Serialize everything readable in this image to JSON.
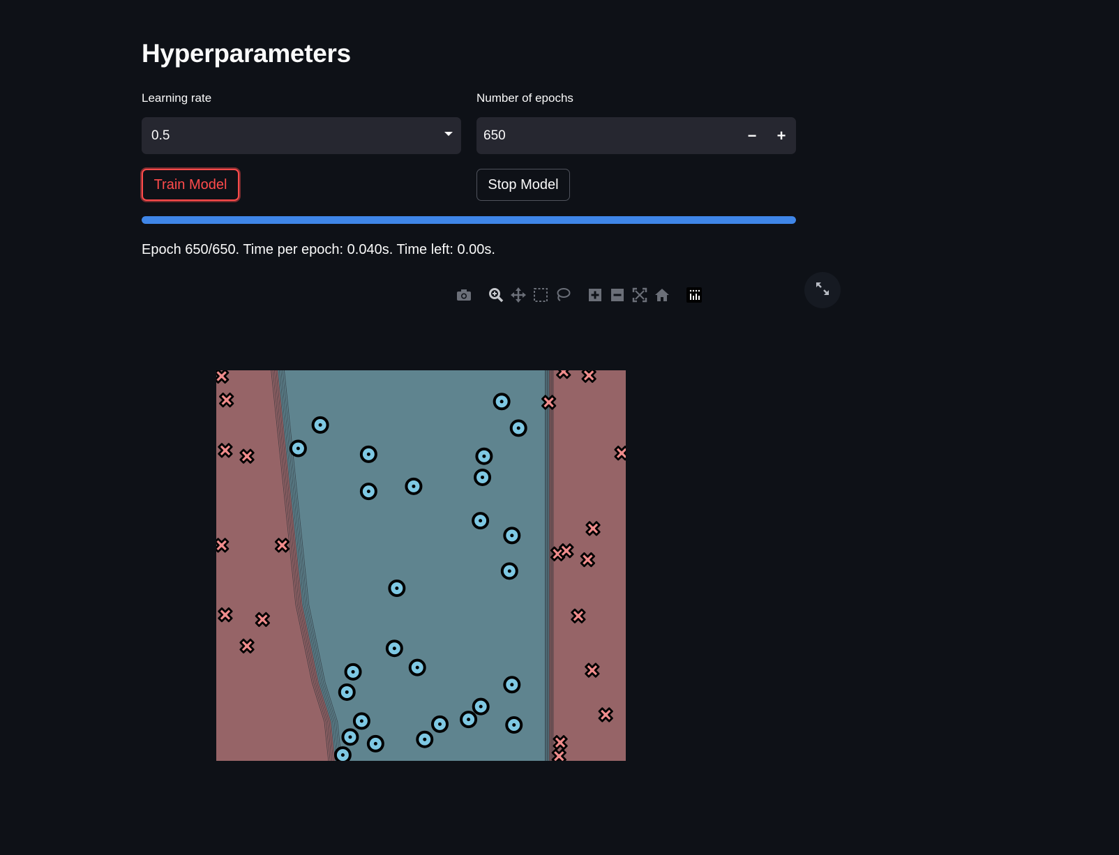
{
  "header": {
    "title": "Hyperparameters"
  },
  "learning_rate": {
    "label": "Learning rate",
    "value": "0.5"
  },
  "epochs": {
    "label": "Number of epochs",
    "value": "650",
    "minus": "−",
    "plus": "+"
  },
  "buttons": {
    "train": "Train Model",
    "stop": "Stop Model"
  },
  "progress": {
    "fraction": 1.0
  },
  "status_text": "Epoch 650/650. Time per epoch: 0.040s. Time left: 0.00s.",
  "modebar": {
    "icons": [
      "camera-icon",
      "zoom-icon",
      "pan-icon",
      "box-select-icon",
      "lasso-select-icon",
      "zoom-in-icon",
      "zoom-out-icon",
      "autoscale-icon",
      "reset-axes-icon",
      "plotly-logo-icon"
    ]
  },
  "colors": {
    "background": "#0e1117",
    "accent": "#ff4b4b",
    "progress": "#3f86e8",
    "region_positive": "#5f848f",
    "region_negative": "#966467",
    "circle_marker": "#7ec8e3",
    "cross_marker": "#f08c8c"
  },
  "chart_data": {
    "type": "scatter",
    "title": "",
    "xlabel": "",
    "ylabel": "",
    "xlim": [
      0,
      1
    ],
    "ylim": [
      0,
      1
    ],
    "grid": false,
    "legend": "none",
    "decision_boundary": {
      "left": [
        [
          0.15,
          1.0
        ],
        [
          0.16,
          0.9
        ],
        [
          0.17,
          0.8
        ],
        [
          0.19,
          0.6
        ],
        [
          0.21,
          0.4
        ],
        [
          0.23,
          0.3
        ],
        [
          0.25,
          0.2
        ],
        [
          0.28,
          0.1
        ],
        [
          0.29,
          0.0
        ]
      ],
      "right": [
        [
          0.813,
          1.0
        ],
        [
          0.813,
          0.5
        ],
        [
          0.813,
          0.0
        ]
      ]
    },
    "series": [
      {
        "marker": "circle",
        "points": [
          [
            0.254,
            0.86
          ],
          [
            0.2,
            0.8
          ],
          [
            0.372,
            0.785
          ],
          [
            0.697,
            0.92
          ],
          [
            0.738,
            0.852
          ],
          [
            0.654,
            0.78
          ],
          [
            0.372,
            0.69
          ],
          [
            0.482,
            0.703
          ],
          [
            0.65,
            0.726
          ],
          [
            0.645,
            0.615
          ],
          [
            0.722,
            0.577
          ],
          [
            0.716,
            0.486
          ],
          [
            0.441,
            0.442
          ],
          [
            0.435,
            0.288
          ],
          [
            0.491,
            0.239
          ],
          [
            0.334,
            0.228
          ],
          [
            0.319,
            0.176
          ],
          [
            0.722,
            0.195
          ],
          [
            0.646,
            0.139
          ],
          [
            0.355,
            0.102
          ],
          [
            0.727,
            0.092
          ],
          [
            0.546,
            0.094
          ],
          [
            0.616,
            0.106
          ],
          [
            0.327,
            0.061
          ],
          [
            0.389,
            0.044
          ],
          [
            0.509,
            0.055
          ],
          [
            0.309,
            0.015
          ]
        ]
      },
      {
        "marker": "x",
        "points": [
          [
            0.013,
            0.985
          ],
          [
            0.025,
            0.924
          ],
          [
            0.022,
            0.795
          ],
          [
            0.075,
            0.78
          ],
          [
            0.848,
            0.997
          ],
          [
            0.91,
            0.987
          ],
          [
            0.812,
            0.918
          ],
          [
            0.99,
            0.788
          ],
          [
            0.92,
            0.595
          ],
          [
            0.013,
            0.552
          ],
          [
            0.161,
            0.552
          ],
          [
            0.834,
            0.53
          ],
          [
            0.855,
            0.538
          ],
          [
            0.907,
            0.515
          ],
          [
            0.022,
            0.374
          ],
          [
            0.113,
            0.362
          ],
          [
            0.075,
            0.294
          ],
          [
            0.884,
            0.371
          ],
          [
            0.918,
            0.232
          ],
          [
            0.951,
            0.118
          ],
          [
            0.84,
            0.047
          ],
          [
            0.837,
            0.012
          ]
        ]
      }
    ]
  }
}
